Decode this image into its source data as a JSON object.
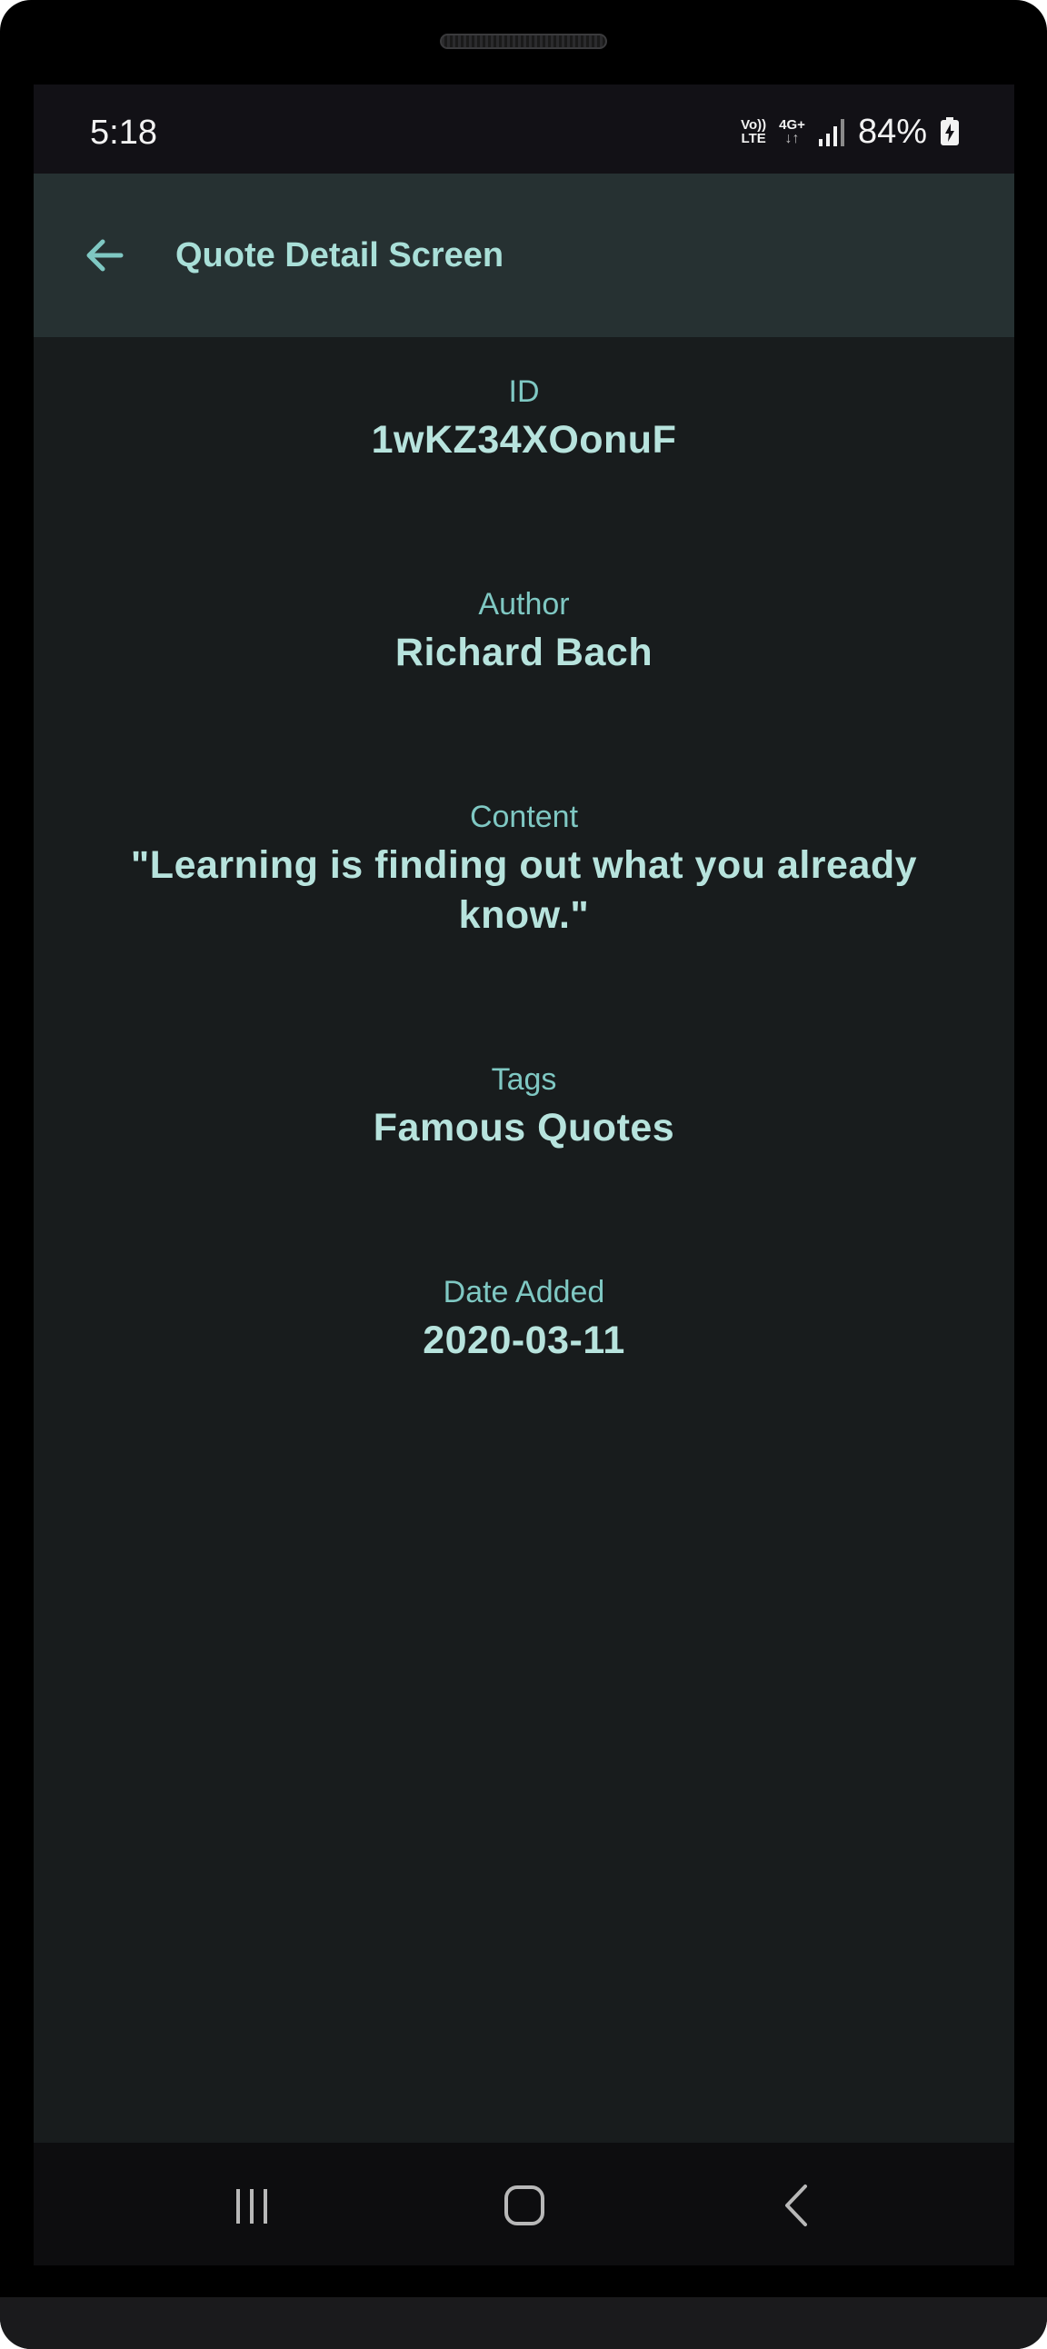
{
  "status_bar": {
    "time": "5:18",
    "volte_top": "Vo))",
    "volte_bottom": "LTE",
    "network_type": "4G+",
    "network_arrows": "↓↑",
    "battery_percent": "84%"
  },
  "app_bar": {
    "title": "Quote Detail Screen",
    "back_icon": "arrow-left-icon"
  },
  "fields": {
    "id": {
      "label": "ID",
      "value": "1wKZ34XOonuF"
    },
    "author": {
      "label": "Author",
      "value": "Richard Bach"
    },
    "content": {
      "label": "Content",
      "value": "\"Learning is finding out what you already know.\""
    },
    "tags": {
      "label": "Tags",
      "value": "Famous Quotes"
    },
    "date_added": {
      "label": "Date Added",
      "value": "2020-03-11"
    }
  },
  "nav_bar": {
    "recents_icon": "recents-icon",
    "home_icon": "home-icon",
    "back_icon": "back-chevron-icon"
  },
  "colors": {
    "app_bar_bg": "#263132",
    "screen_bg": "#181c1d",
    "accent": "#7fc8c3",
    "value_text": "#b7e3dd"
  }
}
